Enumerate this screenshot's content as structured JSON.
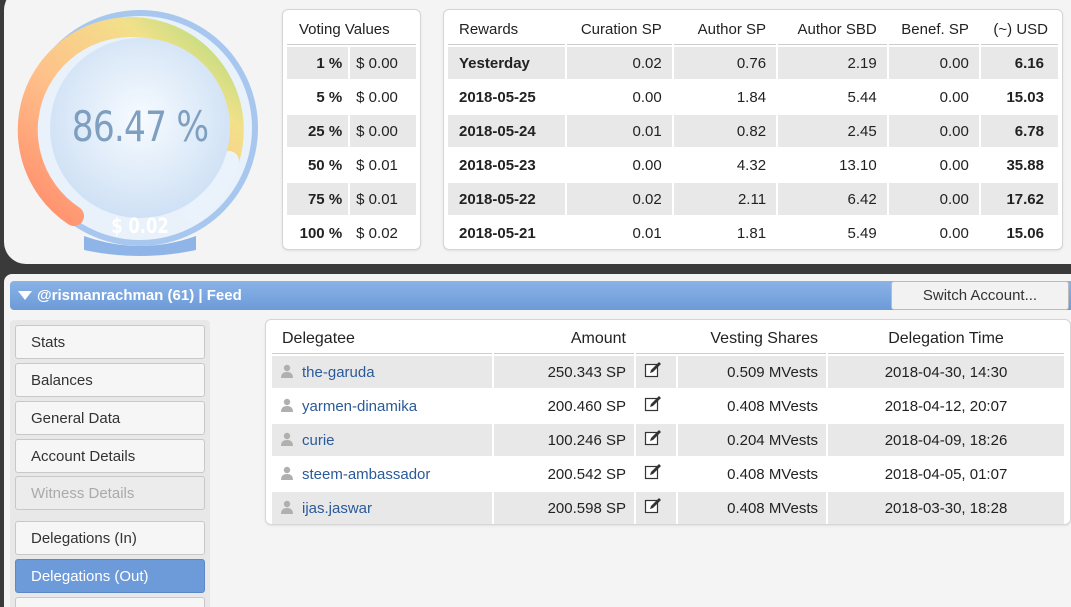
{
  "gauge": {
    "percent_text": "86.47 %",
    "value_text": "$ 0.02",
    "percent": 86.47
  },
  "voting": {
    "header": "Voting Values",
    "rows": [
      {
        "pct": "1 %",
        "val": "$ 0.00"
      },
      {
        "pct": "5 %",
        "val": "$ 0.00"
      },
      {
        "pct": "25 %",
        "val": "$ 0.00"
      },
      {
        "pct": "50 %",
        "val": "$ 0.01"
      },
      {
        "pct": "75 %",
        "val": "$ 0.01"
      },
      {
        "pct": "100 %",
        "val": "$ 0.02"
      }
    ]
  },
  "rewards": {
    "headers": [
      "Rewards",
      "Curation SP",
      "Author SP",
      "Author SBD",
      "Benef. SP",
      "(~) USD"
    ],
    "rows": [
      [
        "Yesterday",
        "0.02",
        "0.76",
        "2.19",
        "0.00",
        "6.16"
      ],
      [
        "2018-05-25",
        "0.00",
        "1.84",
        "5.44",
        "0.00",
        "15.03"
      ],
      [
        "2018-05-24",
        "0.01",
        "0.82",
        "2.45",
        "0.00",
        "6.78"
      ],
      [
        "2018-05-23",
        "0.00",
        "4.32",
        "13.10",
        "0.00",
        "35.88"
      ],
      [
        "2018-05-22",
        "0.02",
        "2.11",
        "6.42",
        "0.00",
        "17.62"
      ],
      [
        "2018-05-21",
        "0.01",
        "1.81",
        "5.49",
        "0.00",
        "15.06"
      ]
    ]
  },
  "account": {
    "title": "@rismanrachman (61)  |  Feed",
    "switch_label": "Switch Account..."
  },
  "menu": [
    {
      "label": "Stats",
      "state": "normal"
    },
    {
      "label": "Balances",
      "state": "normal"
    },
    {
      "label": "General Data",
      "state": "normal"
    },
    {
      "label": "Account Details",
      "state": "normal"
    },
    {
      "label": "Witness Details",
      "state": "disabled"
    },
    {
      "label": "Delegations (In)",
      "state": "normal"
    },
    {
      "label": "Delegations (Out)",
      "state": "active"
    }
  ],
  "delegations": {
    "headers": [
      "Delegatee",
      "Amount",
      "Vesting Shares",
      "Delegation Time"
    ],
    "rows": [
      {
        "name": "the-garuda",
        "amount": "250.343 SP",
        "vests": "0.509 MVests",
        "time": "2018-04-30, 14:30"
      },
      {
        "name": "yarmen-dinamika",
        "amount": "200.460 SP",
        "vests": "0.408 MVests",
        "time": "2018-04-12, 20:07"
      },
      {
        "name": "curie",
        "amount": "100.246 SP",
        "vests": "0.204 MVests",
        "time": "2018-04-09, 18:26"
      },
      {
        "name": "steem-ambassador",
        "amount": "200.542 SP",
        "vests": "0.408 MVests",
        "time": "2018-04-05, 01:07"
      },
      {
        "name": "ijas.jaswar",
        "amount": "200.598 SP",
        "vests": "0.408 MVests",
        "time": "2018-03-30, 18:28"
      }
    ]
  },
  "colors": {
    "accent": "#6d9bd9",
    "link": "#2a5a99"
  }
}
